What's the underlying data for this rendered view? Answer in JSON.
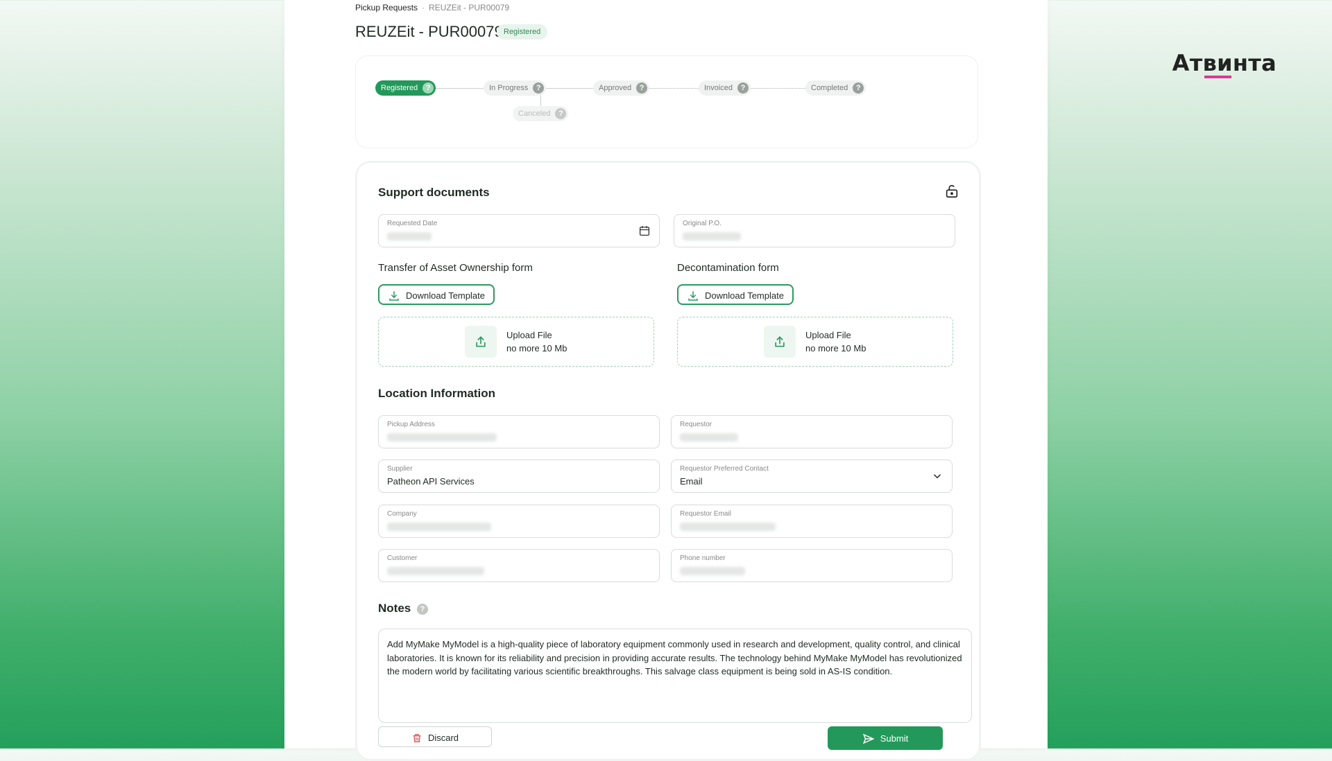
{
  "brand": {
    "name_pre": "Ат",
    "name_mark": "ви",
    "name_post": "нта",
    "accent_color": "#e0369a"
  },
  "breadcrumb": {
    "root": "Pickup Requests",
    "separator": "·",
    "current": "REUZEit - PUR00079"
  },
  "page": {
    "title": "REUZEit - PUR00079",
    "status_badge": "Registered",
    "accent_color": "#22995a"
  },
  "stepper": {
    "steps": [
      {
        "label": "Registered",
        "state": "active"
      },
      {
        "label": "In Progress",
        "state": "pending"
      },
      {
        "label": "Approved",
        "state": "pending"
      },
      {
        "label": "Invoiced",
        "state": "pending"
      },
      {
        "label": "Completed",
        "state": "pending"
      }
    ],
    "branch": {
      "label": "Canceled",
      "state": "disabled"
    },
    "help_glyph": "?"
  },
  "support_documents": {
    "heading": "Support documents",
    "lock_icon": "unlock-icon",
    "requested_date": {
      "label": "Requested Date",
      "icon": "calendar-icon"
    },
    "original_po": {
      "label": "Original P.O."
    },
    "transfer_form": {
      "heading": "Transfer of Asset Ownership form",
      "download_label": "Download Template",
      "upload_label": "Upload File",
      "upload_hint": "no more 10 Mb"
    },
    "decon_form": {
      "heading": "Decontamination form",
      "download_label": "Download Template",
      "upload_label": "Upload File",
      "upload_hint": "no more 10 Mb"
    }
  },
  "location": {
    "heading": "Location Information",
    "pickup_address": {
      "label": "Pickup Address"
    },
    "requestor": {
      "label": "Requestor"
    },
    "supplier": {
      "label": "Supplier",
      "value": "Patheon API Services"
    },
    "preferred_contact": {
      "label": "Requestor Preferred Contact",
      "value": "Email"
    },
    "company": {
      "label": "Company"
    },
    "requestor_email": {
      "label": "Requestor Email"
    },
    "customer": {
      "label": "Customer"
    },
    "phone": {
      "label": "Phone number"
    }
  },
  "notes": {
    "heading": "Notes",
    "text": "Add MyMake MyModel is a high-quality piece of laboratory equipment commonly used in research and development, quality control, and clinical laboratories. It is known for its reliability and precision in providing accurate results. The technology behind MyMake MyModel has revolutionized the modern world by facilitating various scientific breakthroughs. This salvage class equipment is being sold in AS-IS condition."
  },
  "actions": {
    "discard_label": "Discard",
    "submit_label": "Submit",
    "danger_color": "#e05252"
  }
}
